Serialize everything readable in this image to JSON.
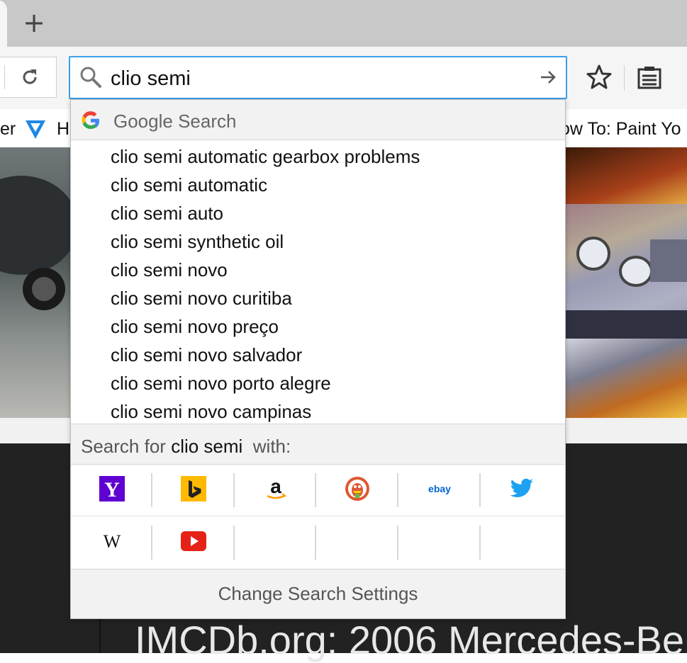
{
  "toolbar": {
    "new_tab_symbol": "+",
    "url_value": "clio semi"
  },
  "bookmarks": {
    "left_fragment": "er",
    "left2_fragment": "H",
    "right_fragment": "ow To: Paint Yo"
  },
  "popup": {
    "engine_name": "Google Search",
    "suggestions": [
      "clio semi automatic gearbox problems",
      "clio semi automatic",
      "clio semi auto",
      "clio semi synthetic oil",
      "clio semi novo",
      "clio semi novo curitiba",
      "clio semi novo preço",
      "clio semi novo salvador",
      "clio semi novo porto alegre",
      "clio semi novo campinas"
    ],
    "search_for_prefix": "Search for",
    "search_for_query": "clio semi",
    "search_for_suffix": "with:",
    "engines_row1": [
      "yahoo-icon",
      "bing-icon",
      "amazon-icon",
      "duckduckgo-icon",
      "ebay-icon",
      "twitter-icon"
    ],
    "engines_row2": [
      "wikipedia-icon",
      "youtube-icon"
    ],
    "ebay_text": "ebay",
    "wikipedia_text": "W",
    "yahoo_text": "Y",
    "amazon_text": "a",
    "change_settings_label": "Change Search Settings"
  },
  "page": {
    "heading_fragment": "IMCDb.org: 2006 Mercedes-Be"
  },
  "colors": {
    "focus_ring": "#3b9fe8",
    "yahoo": "#5f01d1",
    "bing": "#ffb900",
    "twitter": "#1da1f2",
    "youtube": "#e62117",
    "duckduckgo": "#de5833"
  }
}
